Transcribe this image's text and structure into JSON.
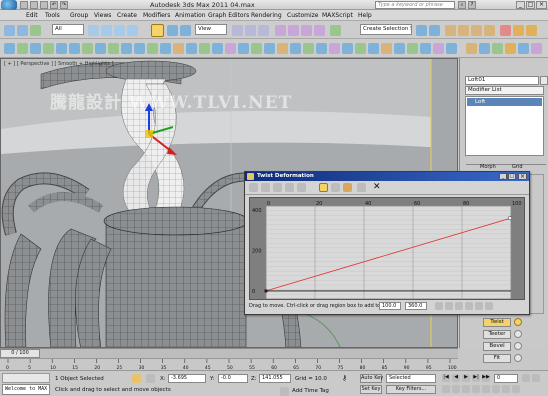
{
  "app": {
    "title": "Autodesk 3ds Max  2011     04.max",
    "search_placeholder": "Type a keyword or phrase"
  },
  "menu": [
    "Edit",
    "Tools",
    "Group",
    "Views",
    "Create",
    "Modifiers",
    "Animation",
    "Graph Editors",
    "Rendering",
    "Customize",
    "MAXScript",
    "Help"
  ],
  "toolbar": {
    "selection_filter": "All",
    "ref_coord": "View",
    "named_selection_placeholder": "Create Selection Set"
  },
  "viewport": {
    "label": "[ + ] [ Perspective ] [ Smooth + Highlights ]",
    "watermark": "騰龍設計 WWW.TLVI.NET"
  },
  "command_panel": {
    "object_name": "Loft01",
    "modifier_list": "Modifier List",
    "stack_item": "Loft",
    "rollout_morph": "Morph",
    "rollout_grid": "Grid",
    "deform_buttons": [
      "Twist",
      "Teeter",
      "Bevel",
      "Fit"
    ]
  },
  "twist_dialog": {
    "title": "Twist Deformation",
    "x_ticks": [
      "0",
      "20",
      "40",
      "60",
      "80",
      "100"
    ],
    "y_ticks": [
      "400",
      "200",
      "0"
    ],
    "status_hint": "Drag to move. Ctrl-click or drag region box to add to a",
    "field_x": "100.0",
    "field_y": "360.0",
    "curve": {
      "start": [
        0,
        0
      ],
      "end": [
        100,
        360
      ]
    }
  },
  "timeline": {
    "frame_label": "0 / 100",
    "ticks": [
      "0",
      "5",
      "10",
      "15",
      "20",
      "25",
      "30",
      "35",
      "40",
      "45",
      "50",
      "55",
      "60",
      "65",
      "70",
      "75",
      "80",
      "85",
      "90",
      "95",
      "100"
    ]
  },
  "status": {
    "welcome": "Welcome to MAX",
    "objects_selected": "1 Object Selected",
    "prompt": "Click and drag to select and move objects",
    "x_label": "X:",
    "x_value": "-3.695",
    "y_label": "Y:",
    "y_value": "-0.0",
    "z_label": "Z:",
    "z_value": "141.055",
    "grid": "Grid = 10.0",
    "auto_key": "Auto Key",
    "set_key": "Set Key",
    "selected": "Selected",
    "key_filters": "Key Filters...",
    "add_time_tag": "Add Time Tag",
    "frame_value": "0"
  }
}
